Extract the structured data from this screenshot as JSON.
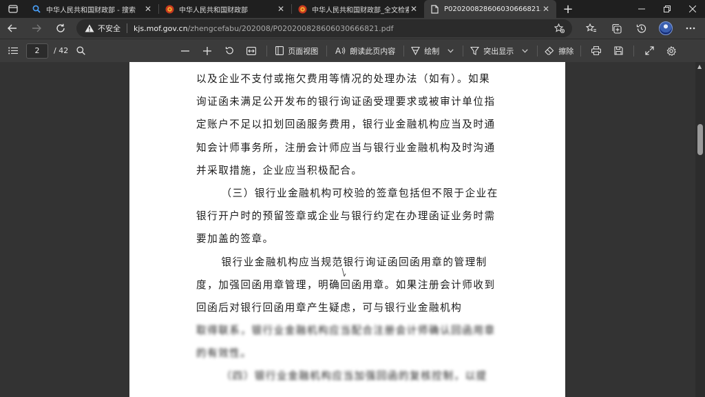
{
  "tabs": [
    {
      "title": "中华人民共和国财政部 - 搜索",
      "icon": "search-icon"
    },
    {
      "title": "中华人民共和国财政部",
      "icon": "mof-emblem-icon"
    },
    {
      "title": "中华人民共和国财政部_全文检索",
      "icon": "mof-emblem-icon"
    },
    {
      "title": "P020200828606030666821.pdf",
      "icon": "document-icon",
      "active": true
    }
  ],
  "address": {
    "security_label": "不安全",
    "url_host": "kjs.mof.gov.cn",
    "url_path": "/zhengcefabu/202008/P020200828606030666821.pdf"
  },
  "pdf_toolbar": {
    "page_current": "2",
    "page_total": "/ 42",
    "page_view_label": "页面视图",
    "read_aloud_label": "朗读此页内容",
    "draw_label": "绘制",
    "highlight_label": "突出显示",
    "erase_label": "擦除"
  },
  "document": {
    "paragraphs": [
      "以及企业不支付或拖欠费用等情况的处理办法（如有）。如果询证函未满足公开发布的银行询证函受理要求或被审计单位指定账户不足以扣划回函服务费用，银行业金融机构应当及时通知会计师事务所，注册会计师应当与银行业金融机构及时沟通并采取措施，企业应当积极配合。",
      "（三）银行业金融机构可校验的签章包括但不限于企业在银行开户时的预留签章或企业与银行约定在办理函证业务时需要加盖的签章。",
      "银行业金融机构应当规范银行询证函回函用章的管理制度，加强回函用章管理，明确回函用章。如果注册会计师收到回函后对银行回函用章产生疑虑，可与银行业金融机构"
    ],
    "blurred_paragraphs": [
      "取得联系，银行业金融机构应当配合注册会计师确认回函用章的有效性。",
      "（四）银行业金融机构应当加强回函的复核控制，以提"
    ]
  },
  "colors": {
    "window_bg": "#1f1f1f",
    "toolbar_bg": "#3b3b3b",
    "viewer_bg": "#333333",
    "page_bg": "#ffffff",
    "text": "#1a1a1a",
    "scroll_marker": "#2d8a3a"
  }
}
